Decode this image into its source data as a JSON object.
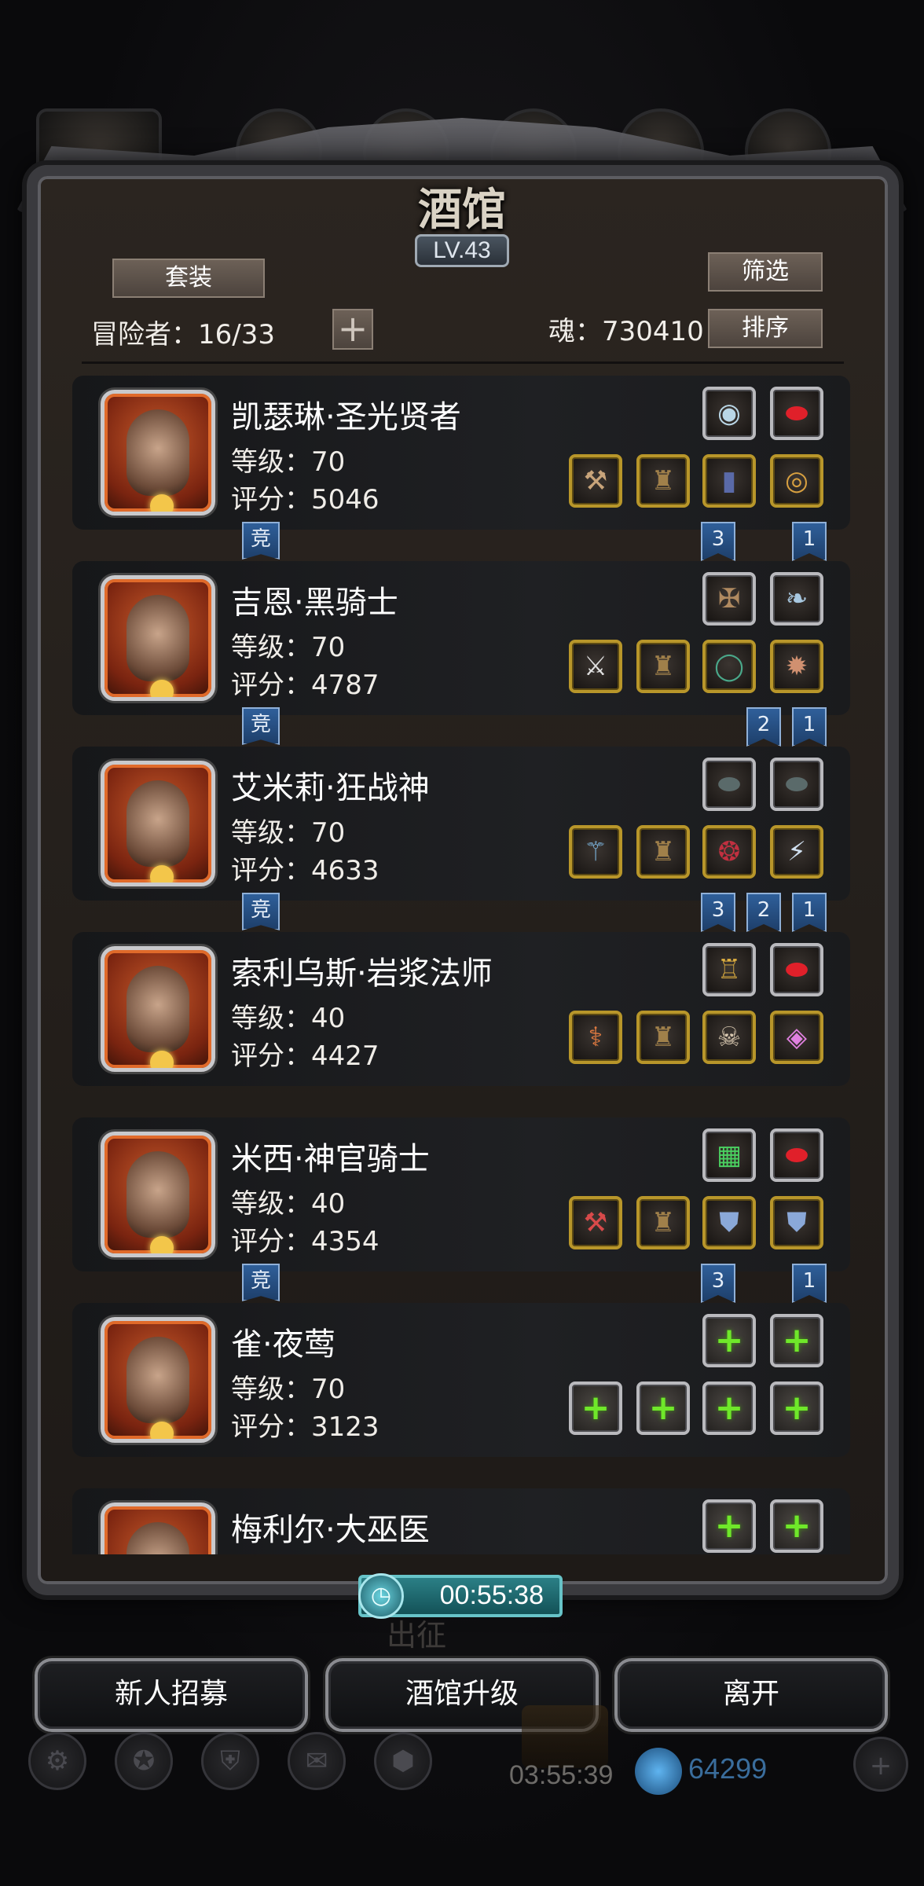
{
  "window": {
    "title": "酒馆",
    "level": "LV.43"
  },
  "header": {
    "set_label": "套装",
    "filter_label": "筛选",
    "sort_label": "排序",
    "adventurer_count": "冒险者：16/33",
    "add_label": "+",
    "soul": "魂：730410"
  },
  "heroes": [
    {
      "name": "凯瑟琳·圣光贤者",
      "level": "等级：70",
      "score": "评分：5046",
      "top_slots": [
        {
          "icon": "crystal-orb-icon",
          "glyph": "◉",
          "color": "#b9d6e6"
        },
        {
          "icon": "red-gem-icon",
          "glyph": "⬬",
          "color": "#e0202a"
        }
      ],
      "bottom_slots": [
        {
          "icon": "hammer-icon",
          "glyph": "⚒",
          "color": "#c8a47a"
        },
        {
          "icon": "cloak-icon",
          "glyph": "♜",
          "color": "#a0804a"
        },
        {
          "icon": "boots-icon",
          "glyph": "▮",
          "color": "#5a6aa8"
        },
        {
          "icon": "ring-icon",
          "glyph": "◎",
          "color": "#d8a040"
        }
      ],
      "tags": [
        "竞",
        "3",
        "1"
      ]
    },
    {
      "name": "吉恩·黑骑士",
      "level": "等级：70",
      "score": "评分：4787",
      "top_slots": [
        {
          "icon": "crossbow-icon",
          "glyph": "✠",
          "color": "#b08a60"
        },
        {
          "icon": "spirit-icon",
          "glyph": "❧",
          "color": "#a8c8e0"
        }
      ],
      "bottom_slots": [
        {
          "icon": "sword-icon",
          "glyph": "⚔",
          "color": "#e0e0e0"
        },
        {
          "icon": "cloak-icon",
          "glyph": "♜",
          "color": "#a0804a"
        },
        {
          "icon": "ring-icon",
          "glyph": "◯",
          "color": "#4aa88a"
        },
        {
          "icon": "medallion-icon",
          "glyph": "✹",
          "color": "#d09070"
        }
      ],
      "tags": [
        "竞",
        "2",
        "1"
      ]
    },
    {
      "name": "艾米莉·狂战神",
      "level": "等级：70",
      "score": "评分：4633",
      "top_slots": [
        {
          "icon": "stone-icon",
          "glyph": "⬬",
          "color": "#5a6a6a"
        },
        {
          "icon": "stone-icon",
          "glyph": "⬬",
          "color": "#5a6a6a"
        }
      ],
      "bottom_slots": [
        {
          "icon": "axe-icon",
          "glyph": "⚚",
          "color": "#7ab0d8"
        },
        {
          "icon": "cloak-icon",
          "glyph": "♜",
          "color": "#a0804a"
        },
        {
          "icon": "amulet-icon",
          "glyph": "❂",
          "color": "#c03040"
        },
        {
          "icon": "claw-icon",
          "glyph": "⚡",
          "color": "#d0e0f0"
        }
      ],
      "tags": [
        "竞",
        "3",
        "2",
        "1"
      ]
    },
    {
      "name": "索利乌斯·岩浆法师",
      "level": "等级：40",
      "score": "评分：4427",
      "top_slots": [
        {
          "icon": "lantern-icon",
          "glyph": "♖",
          "color": "#e0b040"
        },
        {
          "icon": "red-gem-icon",
          "glyph": "⬬",
          "color": "#e0202a"
        }
      ],
      "bottom_slots": [
        {
          "icon": "staff-icon",
          "glyph": "⚕",
          "color": "#e07a40"
        },
        {
          "icon": "cloak-icon",
          "glyph": "♜",
          "color": "#a0804a"
        },
        {
          "icon": "mask-icon",
          "glyph": "☠",
          "color": "#d8c8b0"
        },
        {
          "icon": "rune-icon",
          "glyph": "◈",
          "color": "#e080e0"
        }
      ],
      "tags": []
    },
    {
      "name": "米西·神官骑士",
      "level": "等级：40",
      "score": "评分：4354",
      "top_slots": [
        {
          "icon": "book-icon",
          "glyph": "▦",
          "color": "#4ad060"
        },
        {
          "icon": "red-gem-icon",
          "glyph": "⬬",
          "color": "#e0202a"
        }
      ],
      "bottom_slots": [
        {
          "icon": "mace-icon",
          "glyph": "⚒",
          "color": "#d84a4a"
        },
        {
          "icon": "cloak-icon",
          "glyph": "♜",
          "color": "#a0804a"
        },
        {
          "icon": "armor-icon",
          "glyph": "⛊",
          "color": "#8aa8d8"
        },
        {
          "icon": "armor-icon",
          "glyph": "⛊",
          "color": "#8aa8d8"
        }
      ],
      "tags": [
        "竞",
        "3",
        "1"
      ]
    },
    {
      "name": "雀·夜莺",
      "level": "等级：70",
      "score": "评分：3123",
      "top_slots": [
        {
          "icon": "add-equipment-icon",
          "glyph": "+",
          "color": "#6fe82a"
        },
        {
          "icon": "add-equipment-icon",
          "glyph": "+",
          "color": "#6fe82a"
        }
      ],
      "bottom_slots": [
        {
          "icon": "add-equipment-icon",
          "glyph": "+",
          "color": "#6fe82a"
        },
        {
          "icon": "add-equipment-icon",
          "glyph": "+",
          "color": "#6fe82a"
        },
        {
          "icon": "add-equipment-icon",
          "glyph": "+",
          "color": "#6fe82a"
        },
        {
          "icon": "add-equipment-icon",
          "glyph": "+",
          "color": "#6fe82a"
        }
      ],
      "tags": []
    },
    {
      "name": "梅利尔·大巫医",
      "level": "",
      "score": "",
      "top_slots": [
        {
          "icon": "add-equipment-icon",
          "glyph": "+",
          "color": "#6fe82a"
        },
        {
          "icon": "add-equipment-icon",
          "glyph": "+",
          "color": "#6fe82a"
        }
      ],
      "bottom_slots": [],
      "tags": []
    }
  ],
  "footer": {
    "timer": "00:55:38",
    "depart": "出征",
    "recruit_label": "新人招募",
    "upgrade_label": "酒馆升级",
    "leave_label": "离开",
    "bottom_timer": "03:55:39",
    "gems": "64299"
  }
}
